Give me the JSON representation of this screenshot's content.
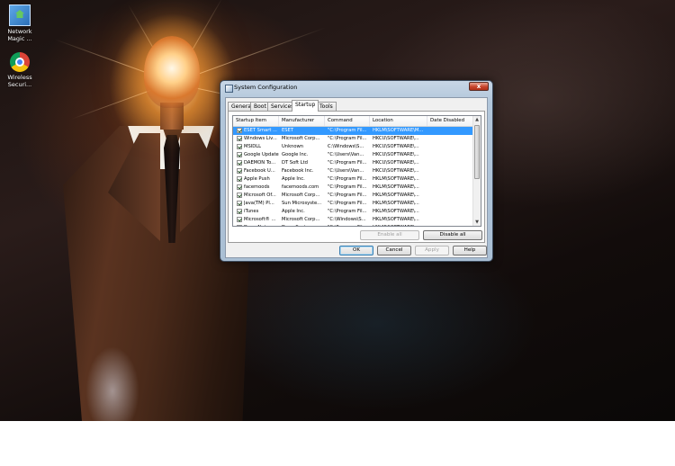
{
  "desktop": {
    "icons": [
      {
        "label": "Network Magic ...",
        "icon": "network-magic-icon"
      },
      {
        "label": "Wireless Securi...",
        "icon": "chrome-icon"
      }
    ]
  },
  "dialog": {
    "title": "System Configuration",
    "close_label": "x",
    "tabs": [
      "General",
      "Boot",
      "Services",
      "Startup",
      "Tools"
    ],
    "active_tab": "Startup",
    "columns": [
      "Startup Item",
      "Manufacturer",
      "Command",
      "Location",
      "Date Disabled"
    ],
    "rows": [
      {
        "item": "ESET Smart ...",
        "manufacturer": "ESET",
        "command": "\"C:\\Program Fil...",
        "location": "HKLM\\SOFTWARE\\M...",
        "date_disabled": "",
        "checked": true,
        "selected": true
      },
      {
        "item": "Windows Liv...",
        "manufacturer": "Microsoft Corp...",
        "command": "\"C:\\Program Fil...",
        "location": "HKCU\\SOFTWARE\\...",
        "date_disabled": "",
        "checked": true,
        "selected": false
      },
      {
        "item": "MSIDLL",
        "manufacturer": "Unknown",
        "command": "C:\\Windows\\S...",
        "location": "HKCU\\SOFTWARE\\...",
        "date_disabled": "",
        "checked": true,
        "selected": false
      },
      {
        "item": "Google Update",
        "manufacturer": "Google Inc.",
        "command": "\"C:\\Users\\Van...",
        "location": "HKCU\\SOFTWARE\\...",
        "date_disabled": "",
        "checked": true,
        "selected": false
      },
      {
        "item": "DAEMON To...",
        "manufacturer": "DT Soft Ltd",
        "command": "\"C:\\Program Fil...",
        "location": "HKCU\\SOFTWARE\\...",
        "date_disabled": "",
        "checked": true,
        "selected": false
      },
      {
        "item": "Facebook U...",
        "manufacturer": "Facebook Inc.",
        "command": "\"C:\\Users\\Van...",
        "location": "HKCU\\SOFTWARE\\...",
        "date_disabled": "",
        "checked": true,
        "selected": false
      },
      {
        "item": "Apple Push",
        "manufacturer": "Apple Inc.",
        "command": "\"C:\\Program Fil...",
        "location": "HKLM\\SOFTWARE\\...",
        "date_disabled": "",
        "checked": true,
        "selected": false
      },
      {
        "item": "facemoods",
        "manufacturer": "facemoods.com",
        "command": "\"C:\\Program Fil...",
        "location": "HKLM\\SOFTWARE\\...",
        "date_disabled": "",
        "checked": true,
        "selected": false
      },
      {
        "item": "Microsoft Of...",
        "manufacturer": "Microsoft Corp...",
        "command": "\"C:\\Program Fil...",
        "location": "HKLM\\SOFTWARE\\...",
        "date_disabled": "",
        "checked": true,
        "selected": false
      },
      {
        "item": "Java(TM) Pl...",
        "manufacturer": "Sun Microsyste...",
        "command": "\"C:\\Program Fil...",
        "location": "HKLM\\SOFTWARE\\...",
        "date_disabled": "",
        "checked": true,
        "selected": false
      },
      {
        "item": "iTunes",
        "manufacturer": "Apple Inc.",
        "command": "\"C:\\Program Fil...",
        "location": "HKLM\\SOFTWARE\\...",
        "date_disabled": "",
        "checked": true,
        "selected": false
      },
      {
        "item": "Microsoft® ...",
        "manufacturer": "Microsoft Corp...",
        "command": "\"C:\\Windows\\S...",
        "location": "HKLM\\SOFTWARE\\...",
        "date_disabled": "",
        "checked": true,
        "selected": false
      },
      {
        "item": "Dune Netwo...",
        "manufacturer": "Dune Systems...",
        "command": "\"C:\\Program Fil...",
        "location": "HKLM\\SOFTWARE\\...",
        "date_disabled": "",
        "checked": true,
        "selected": false
      }
    ],
    "buttons": {
      "enable_all": "Enable all",
      "disable_all": "Disable all",
      "ok": "OK",
      "cancel": "Cancel",
      "apply": "Apply",
      "help": "Help"
    }
  },
  "colors": {
    "selection": "#3399ff",
    "dialog_frame": "#aabfd4",
    "close_button": "#c7452c"
  }
}
